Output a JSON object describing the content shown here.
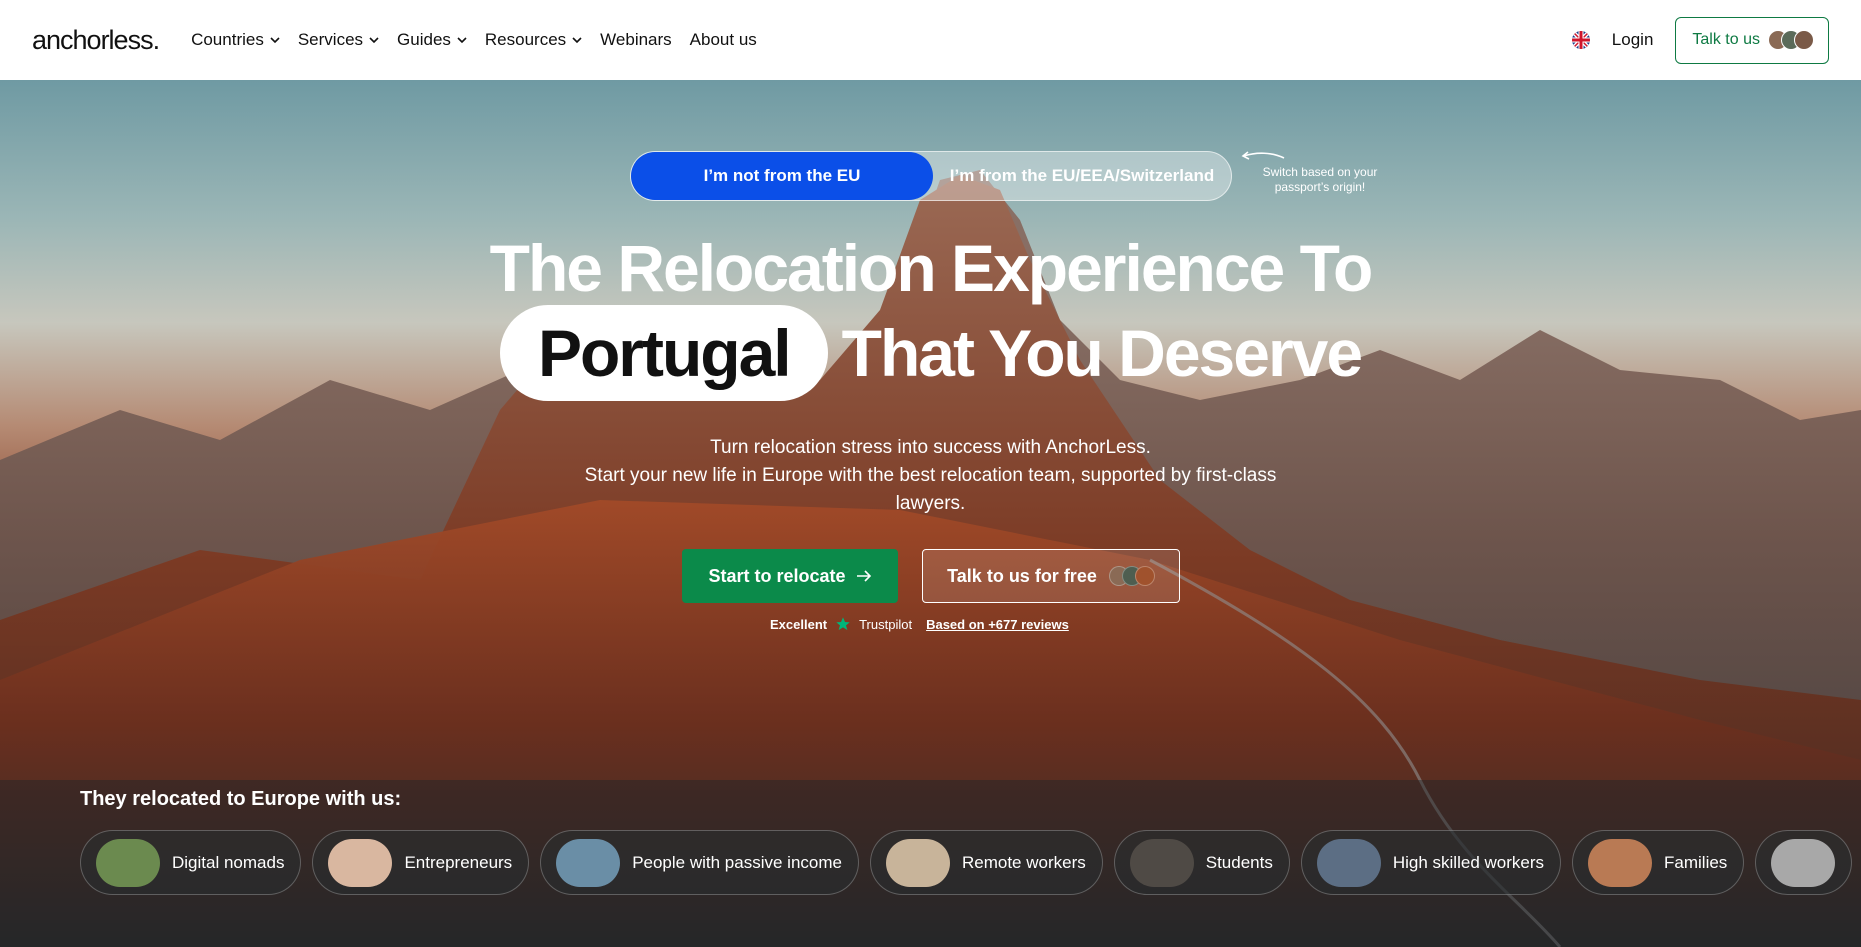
{
  "header": {
    "logo": "anchorless.",
    "nav": [
      {
        "label": "Countries",
        "dropdown": true
      },
      {
        "label": "Services",
        "dropdown": true
      },
      {
        "label": "Guides",
        "dropdown": true
      },
      {
        "label": "Resources",
        "dropdown": true
      },
      {
        "label": "Webinars",
        "dropdown": false
      },
      {
        "label": "About us",
        "dropdown": false
      }
    ],
    "language_icon": "uk-flag-icon",
    "login": "Login",
    "talk_button": "Talk to us"
  },
  "hero": {
    "toggle": {
      "active": "I’m not from the EU",
      "inactive": "I’m from the EU/EEA/Switzerland"
    },
    "switch_hint": "Switch based on your passport’s origin!",
    "headline_line1": "The Relocation Experience To",
    "headline_highlight": "Portugal",
    "headline_line2": "That You Deserve",
    "subtitle_line1": "Turn relocation stress into success with AnchorLess.",
    "subtitle_line2": "Start your new life in Europe with the best relocation team, supported by first-class lawyers.",
    "cta_primary": "Start to relocate",
    "cta_secondary": "Talk to us for free",
    "trust": {
      "rating": "Excellent",
      "provider": "Trustpilot",
      "reviews_link": "Based on +677 reviews"
    },
    "relocated_title": "They relocated to Europe with us:",
    "chips": [
      {
        "label": "Digital nomads",
        "color": "#6b8a4f"
      },
      {
        "label": "Entrepreneurs",
        "color": "#d9b7a0"
      },
      {
        "label": "People with passive income",
        "color": "#6a8ea6"
      },
      {
        "label": "Remote workers",
        "color": "#c8b49a"
      },
      {
        "label": "Students",
        "color": "#4f4a45"
      },
      {
        "label": "High skilled workers",
        "color": "#5c6e84"
      },
      {
        "label": "Families",
        "color": "#b97a54"
      },
      {
        "label": "",
        "color": "#a8a8a8"
      }
    ]
  },
  "colors": {
    "brand_green": "#0b8a4a",
    "toggle_blue": "#0b4fe8"
  }
}
